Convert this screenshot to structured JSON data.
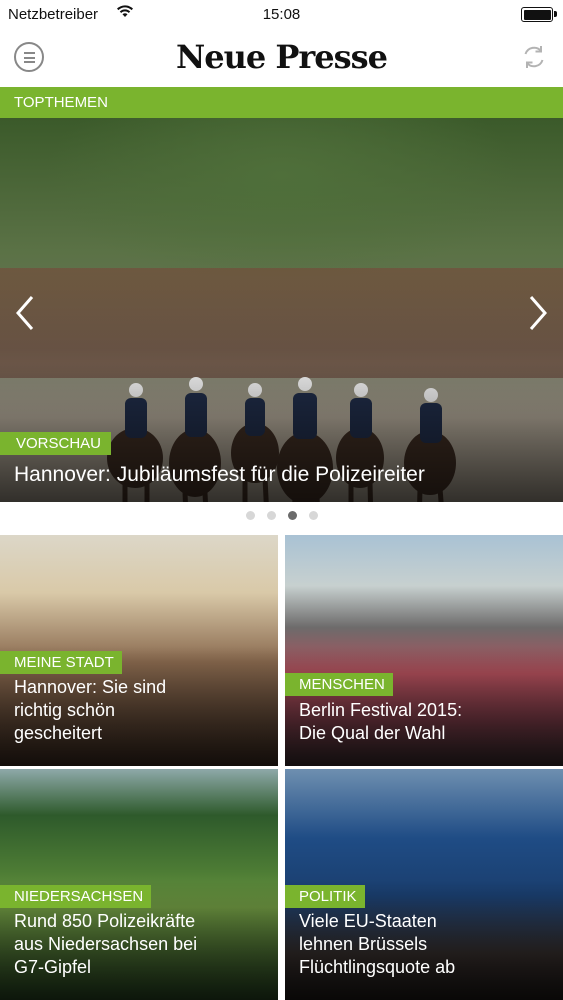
{
  "status_bar": {
    "carrier": "Netzbetreiber",
    "time": "15:08"
  },
  "header": {
    "logo": "Neue Presse"
  },
  "section": {
    "label": "TOPTHEMEN"
  },
  "hero": {
    "tag": "VORSCHAU",
    "title": "Hannover: Jubiläumsfest für die Polizeireiter",
    "page_indicator": {
      "total": 4,
      "active_index": 2
    }
  },
  "cards": [
    {
      "tag": "MEINE STADT",
      "title_lines": [
        "Hannover: Sie sind",
        "richtig schön",
        "gescheitert"
      ]
    },
    {
      "tag": "MENSCHEN",
      "title_lines": [
        "Berlin Festival 2015:",
        "Die Qual der Wahl"
      ]
    },
    {
      "tag": "NIEDERSACHSEN",
      "title_lines": [
        "Rund 850 Polizeikräfte",
        "aus Niedersachsen bei",
        "G7-Gipfel"
      ]
    },
    {
      "tag": "POLITIK",
      "title_lines": [
        "Viele EU-Staaten",
        "lehnen Brüssels",
        "Flüchtlingsquote ab"
      ]
    }
  ],
  "colors": {
    "accent": "#7ab42e"
  }
}
